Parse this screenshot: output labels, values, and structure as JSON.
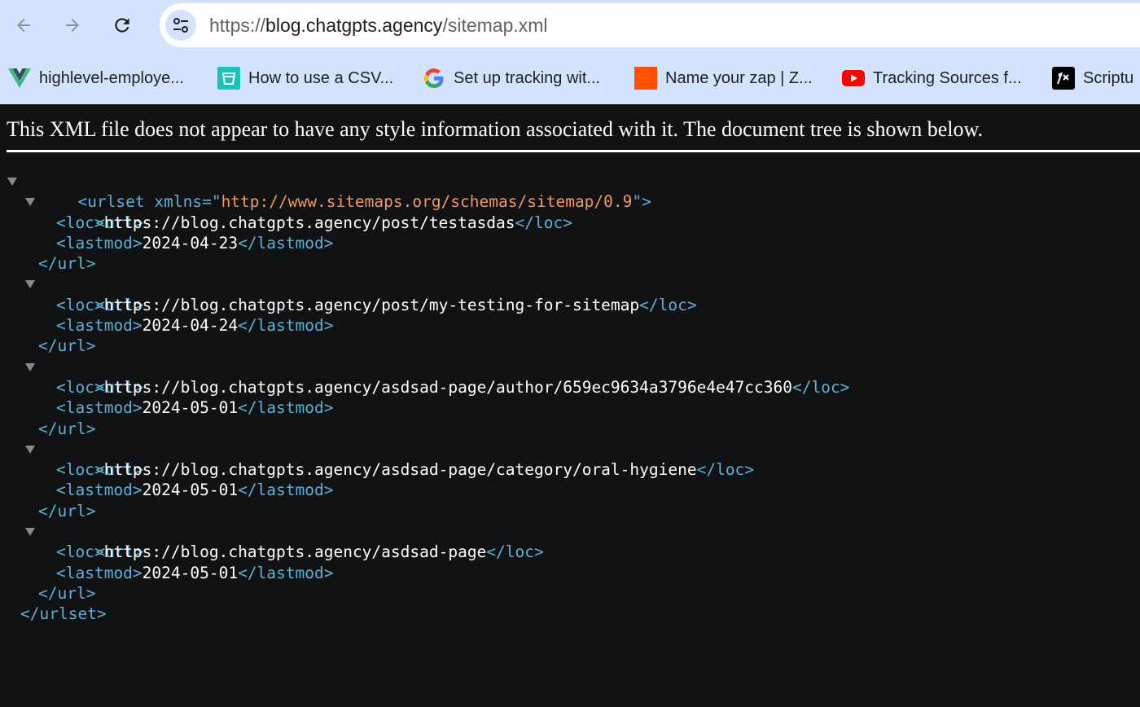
{
  "browser": {
    "url_scheme": "https://",
    "url_host": "blog.chatgpts.agency",
    "url_path": "/sitemap.xml"
  },
  "bookmarks": [
    {
      "label": "highlevel-employe...",
      "icon": "vue-logo-icon"
    },
    {
      "label": "How to use a CSV...",
      "icon": "bucket-logo-icon"
    },
    {
      "label": "Set up tracking wit...",
      "icon": "google-logo-icon"
    },
    {
      "label": "Name your zap | Z...",
      "icon": "zapier-logo-icon"
    },
    {
      "label": "Tracking Sources f...",
      "icon": "youtube-logo-icon"
    },
    {
      "label": "Scriptu",
      "icon": "scriptu-logo-icon"
    }
  ],
  "page": {
    "notice": "This XML file does not appear to have any style information associated with it. The document tree is shown below."
  },
  "xml": {
    "urlset_open": "<urlset",
    "xmlns_attr": " xmlns=\"",
    "xmlns_value": "http://www.sitemaps.org/schemas/sitemap/0.9",
    "xmlns_close": "\">",
    "url_open": "<url>",
    "url_close": "</url>",
    "loc_open": "<loc>",
    "loc_close": "</loc>",
    "lastmod_open": "<lastmod>",
    "lastmod_close": "</lastmod>",
    "urlset_close": "</urlset>",
    "entries": [
      {
        "loc": "https://blog.chatgpts.agency/post/testasdas",
        "lastmod": "2024-04-23"
      },
      {
        "loc": "https://blog.chatgpts.agency/post/my-testing-for-sitemap",
        "lastmod": "2024-04-24"
      },
      {
        "loc": "https://blog.chatgpts.agency/asdsad-page/author/659ec9634a3796e4e47cc360",
        "lastmod": "2024-05-01"
      },
      {
        "loc": "https://blog.chatgpts.agency/asdsad-page/category/oral-hygiene",
        "lastmod": "2024-05-01"
      },
      {
        "loc": "https://blog.chatgpts.agency/asdsad-page",
        "lastmod": "2024-05-01"
      }
    ]
  }
}
